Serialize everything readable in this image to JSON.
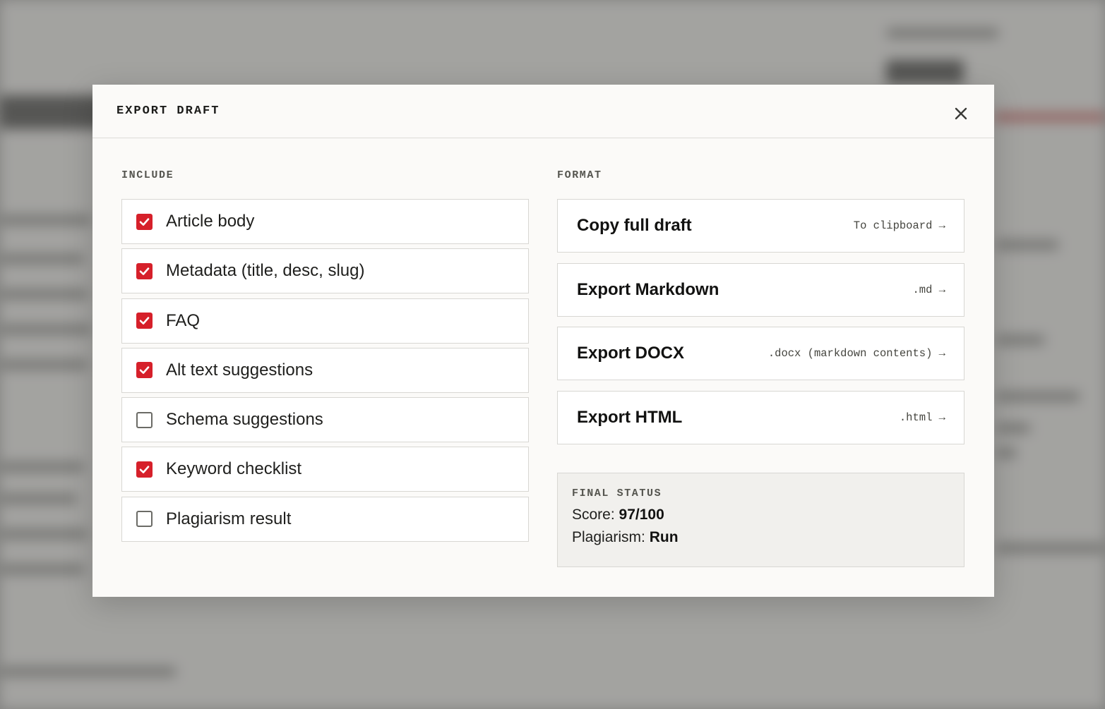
{
  "modal": {
    "title": "EXPORT DRAFT"
  },
  "include": {
    "label": "INCLUDE",
    "items": [
      {
        "label": "Article body",
        "checked": true
      },
      {
        "label": "Metadata (title, desc, slug)",
        "checked": true
      },
      {
        "label": "FAQ",
        "checked": true
      },
      {
        "label": "Alt text suggestions",
        "checked": true
      },
      {
        "label": "Schema suggestions",
        "checked": false
      },
      {
        "label": "Keyword checklist",
        "checked": true
      },
      {
        "label": "Plagiarism result",
        "checked": false
      }
    ]
  },
  "format": {
    "label": "FORMAT",
    "options": [
      {
        "label": "Copy full draft",
        "hint": "To clipboard →"
      },
      {
        "label": "Export Markdown",
        "hint": ".md →"
      },
      {
        "label": "Export DOCX",
        "hint": ".docx (markdown contents) →"
      },
      {
        "label": "Export HTML",
        "hint": ".html →"
      }
    ]
  },
  "status": {
    "title": "FINAL STATUS",
    "score_label": "Score:",
    "score_value": "97/100",
    "plagiarism_label": "Plagiarism:",
    "plagiarism_value": "Run"
  },
  "colors": {
    "accent": "#d6202a",
    "modal_bg": "#fbfaf8",
    "border": "#d8d7d3"
  }
}
